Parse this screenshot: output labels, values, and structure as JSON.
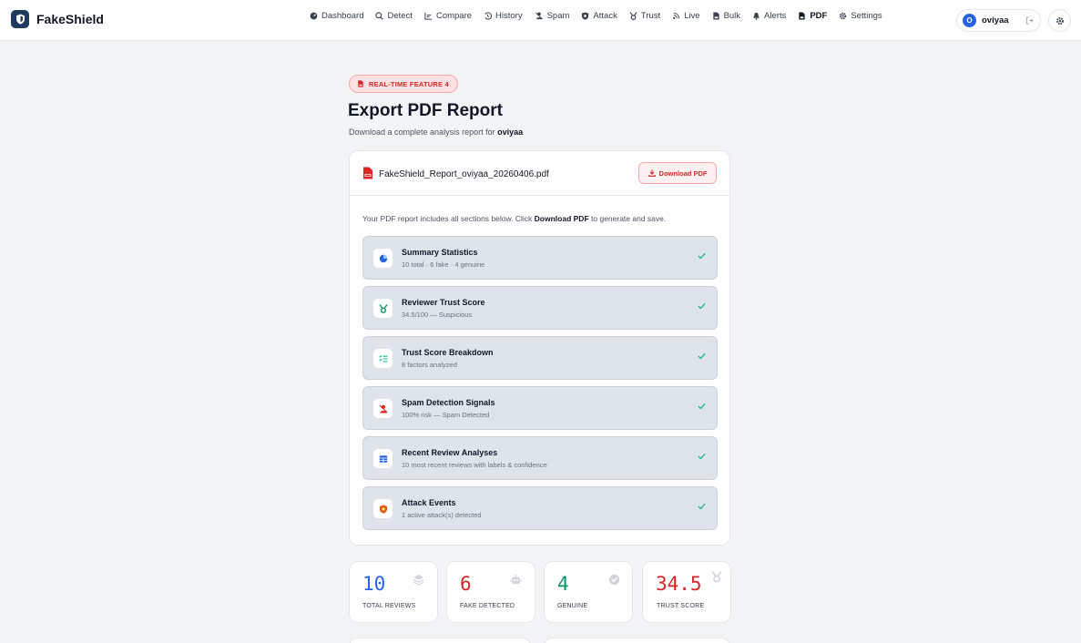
{
  "brand": {
    "name": "FakeShield"
  },
  "nav": {
    "items": [
      {
        "label": "Dashboard",
        "icon": "dashboard-icon"
      },
      {
        "label": "Detect",
        "icon": "search-icon"
      },
      {
        "label": "Compare",
        "icon": "chart-icon"
      },
      {
        "label": "History",
        "icon": "history-icon"
      },
      {
        "label": "Spam",
        "icon": "spam-icon"
      },
      {
        "label": "Attack",
        "icon": "shield-icon"
      },
      {
        "label": "Trust",
        "icon": "medal-icon"
      },
      {
        "label": "Live",
        "icon": "live-icon"
      },
      {
        "label": "Bulk",
        "icon": "bulk-icon"
      },
      {
        "label": "Alerts",
        "icon": "bell-icon"
      },
      {
        "label": "PDF",
        "icon": "pdf-icon",
        "active": true
      },
      {
        "label": "Settings",
        "icon": "gear-icon"
      }
    ],
    "user": {
      "initial": "O",
      "name": "oviyaa"
    }
  },
  "header": {
    "badge": "REAL-TIME FEATURE 4",
    "title": "Export PDF Report",
    "subtitle_prefix": "Download a complete analysis report for ",
    "subtitle_user": "oviyaa"
  },
  "report": {
    "filename": "FakeShield_Report_oviyaa_20260406.pdf",
    "download_label": "Download PDF",
    "intro_prefix": "Your PDF report includes all sections below. Click ",
    "intro_bold": "Download PDF",
    "intro_suffix": " to generate and save.",
    "sections": [
      {
        "title": "Summary Statistics",
        "subtitle": "10 total · 6 fake · 4 genuine",
        "icon": "pie-chart-icon"
      },
      {
        "title": "Reviewer Trust Score",
        "subtitle": "34.5/100 — Suspicious",
        "icon": "medal-icon"
      },
      {
        "title": "Trust Score Breakdown",
        "subtitle": "8 factors analyzed",
        "icon": "list-icon"
      },
      {
        "title": "Spam Detection Signals",
        "subtitle": "100% risk — Spam Detected",
        "icon": "spam-icon"
      },
      {
        "title": "Recent Review Analyses",
        "subtitle": "10 most recent reviews with labels & confidence",
        "icon": "table-icon"
      },
      {
        "title": "Attack Events",
        "subtitle": "1 active attack(s) detected",
        "icon": "shield-icon"
      }
    ]
  },
  "stats": [
    {
      "value": "10",
      "label": "TOTAL REVIEWS",
      "color": "#2563eb",
      "icon": "stack-icon"
    },
    {
      "value": "6",
      "label": "FAKE DETECTED",
      "color": "#dc2626",
      "icon": "robot-icon"
    },
    {
      "value": "4",
      "label": "GENUINE",
      "color": "#059669",
      "icon": "check-circle-icon"
    },
    {
      "value": "34.5",
      "label": "TRUST SCORE",
      "color": "#dc2626",
      "icon": "medal-icon"
    }
  ],
  "colors": {
    "accent_red": "#dc2626",
    "brand_navy": "#1e3a5f",
    "check_green": "#10b981"
  }
}
